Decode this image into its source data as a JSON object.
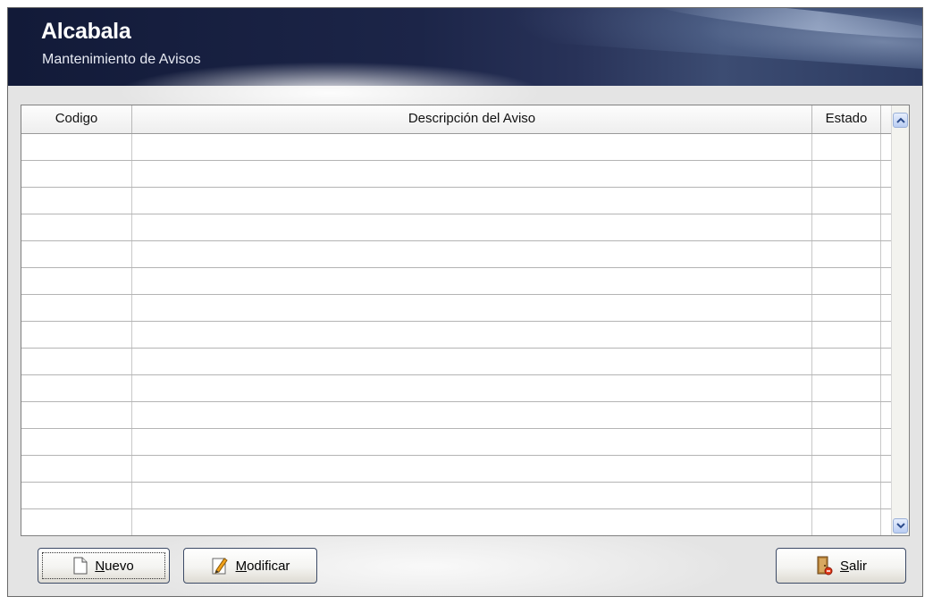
{
  "header": {
    "title": "Alcabala",
    "subtitle": "Mantenimiento de Avisos"
  },
  "grid": {
    "columns": [
      "Codigo",
      "Descripción del Aviso",
      "Estado"
    ],
    "rows": [
      [
        "",
        "",
        ""
      ],
      [
        "",
        "",
        ""
      ],
      [
        "",
        "",
        ""
      ],
      [
        "",
        "",
        ""
      ],
      [
        "",
        "",
        ""
      ],
      [
        "",
        "",
        ""
      ],
      [
        "",
        "",
        ""
      ],
      [
        "",
        "",
        ""
      ],
      [
        "",
        "",
        ""
      ],
      [
        "",
        "",
        ""
      ],
      [
        "",
        "",
        ""
      ],
      [
        "",
        "",
        ""
      ],
      [
        "",
        "",
        ""
      ],
      [
        "",
        "",
        ""
      ],
      [
        "",
        "",
        ""
      ]
    ]
  },
  "buttons": {
    "nuevo": {
      "accel": "N",
      "rest": "uevo",
      "icon": "document-icon"
    },
    "modificar": {
      "accel": "M",
      "rest": "odificar",
      "icon": "pencil-icon"
    },
    "salir": {
      "accel": "S",
      "rest": "alir",
      "icon": "door-exit-icon"
    }
  },
  "colors": {
    "header_dark": "#121a38",
    "frame_bg": "#e4e4e4",
    "scroll_accent": "#b9cdf3"
  }
}
